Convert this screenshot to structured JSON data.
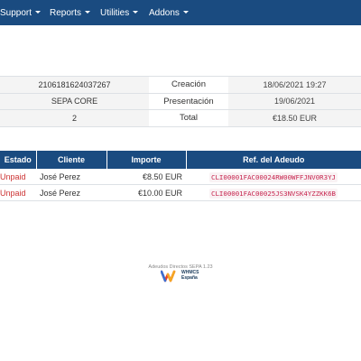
{
  "nav": {
    "items": [
      {
        "label": "Support"
      },
      {
        "label": "Reports"
      },
      {
        "label": "Utilities"
      },
      {
        "label": "Addons"
      }
    ]
  },
  "info": {
    "rows": [
      {
        "value": "2106181624037267",
        "label": "Creación",
        "detail": "18/06/2021 19:27"
      },
      {
        "value": "SEPA CORE",
        "label": "Presentación",
        "detail": "19/06/2021"
      },
      {
        "value": "2",
        "label": "Total",
        "detail": "€18.50 EUR"
      }
    ]
  },
  "invoices": {
    "headers": {
      "estado": "Estado",
      "cliente": "Cliente",
      "importe": "Importe",
      "ref": "Ref. del Adeudo"
    },
    "rows": [
      {
        "estado": "Unpaid",
        "cliente": "José Perez",
        "importe": "€8.50 EUR",
        "ref": "CLI00001FAC00024RW00WFFJNV0R3YJ"
      },
      {
        "estado": "Unpaid",
        "cliente": "José Perez",
        "importe": "€10.00 EUR",
        "ref": "CLI00001FAC00025JS3NVSK4YZZKK6B"
      }
    ]
  },
  "footer": {
    "version": "Adeudos Directos SEPA 1.23",
    "logo_line1": "WHMCS",
    "logo_line2": "España"
  },
  "colors": {
    "nav_bg": "#1a4b80",
    "status_unpaid": "#cc3333",
    "ref_code": "#c7254e"
  }
}
